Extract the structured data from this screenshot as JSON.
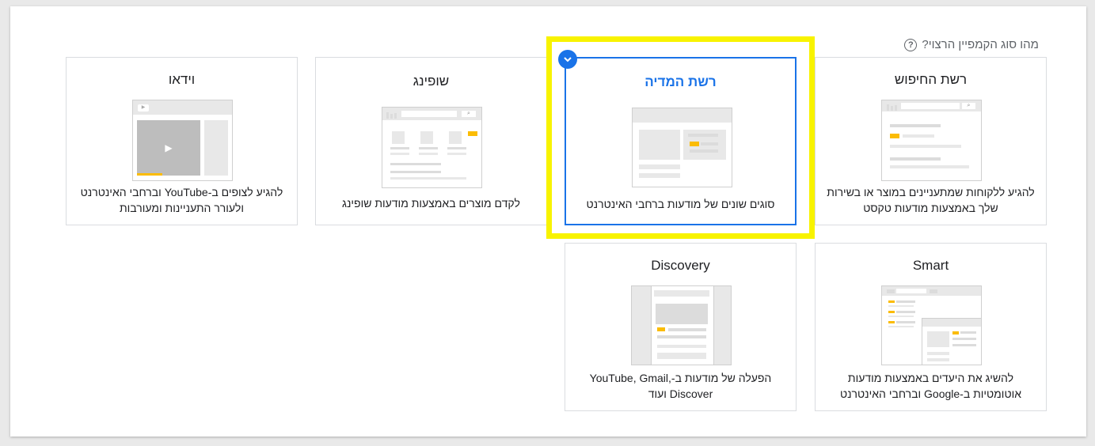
{
  "question": {
    "text": "מהו סוג הקמפיין הרצוי?",
    "help_icon": "help-circle-icon"
  },
  "cards": [
    {
      "id": "search",
      "title": "רשת החיפוש",
      "description": "להגיע ללקוחות שמתעניינים במוצר או בשירות שלך באמצעות מודעות טקסט",
      "selected": false
    },
    {
      "id": "display",
      "title": "רשת המדיה",
      "description": "סוגים שונים של מודעות ברחבי האינטרנט",
      "selected": true
    },
    {
      "id": "shopping",
      "title": "שופינג",
      "description": "לקדם מוצרים באמצעות מודעות שופינג",
      "selected": false
    },
    {
      "id": "video",
      "title": "וידאו",
      "description": "להגיע לצופים ב-YouTube וברחבי האינטרנט ולעורר התעניינות ומעורבות",
      "selected": false
    },
    {
      "id": "smart",
      "title": "Smart",
      "description": "להשיג את היעדים באמצעות מודעות אוטומטיות ב-Google וברחבי האינטרנט",
      "selected": false
    },
    {
      "id": "discovery",
      "title": "Discovery",
      "description": "הפעלה של מודעות ב-YouTube, Gmail, Discover ועוד",
      "selected": false
    }
  ],
  "colors": {
    "accent": "#1a73e8",
    "highlight": "#f8f300",
    "ad_yellow": "#fbbc04"
  }
}
